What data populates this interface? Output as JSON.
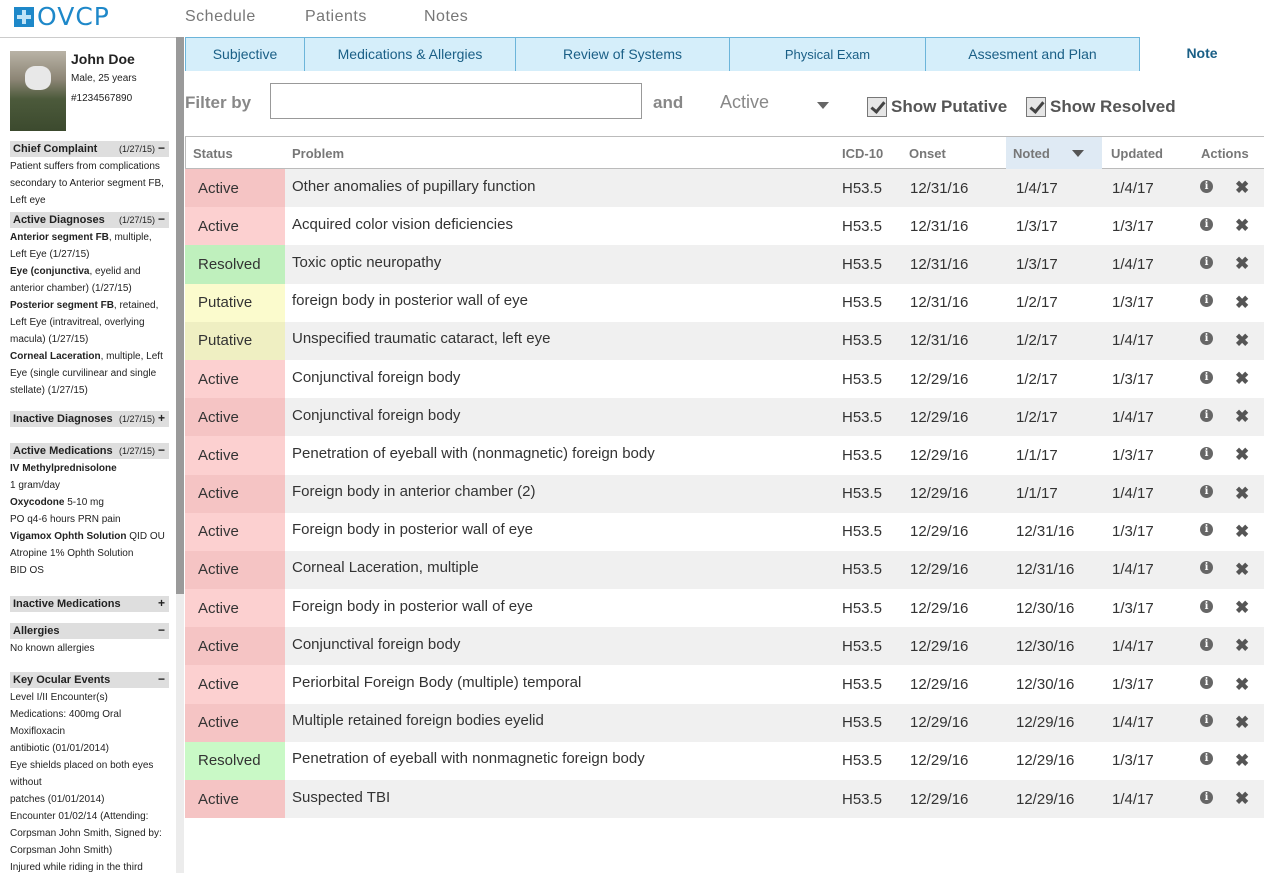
{
  "app": {
    "logo": "OVCP"
  },
  "nav": {
    "items": [
      "Schedule",
      "Patients",
      "Notes"
    ]
  },
  "patient": {
    "name": "John Doe",
    "info": "Male, 25 years",
    "id": "#1234567890"
  },
  "sidebar": {
    "chief": {
      "title": "Chief Complaint",
      "date": "(1/27/15)",
      "toggle": "−",
      "text": "Patient suffers from complications secondary to Anterior segment FB, Left eye"
    },
    "active_dx": {
      "title": "Active Diagnoses",
      "date": "(1/27/15)",
      "toggle": "−",
      "items": [
        {
          "bold": "Anterior segment FB",
          "rest": ", multiple, Left Eye (1/27/15)"
        },
        {
          "bold": "Eye (conjunctiva",
          "rest": ", eyelid and anterior chamber) (1/27/15)"
        },
        {
          "bold": "Posterior segment FB",
          "rest": ", retained, Left Eye (intravitreal, overlying macula) (1/27/15)"
        },
        {
          "bold": "Corneal Laceration",
          "rest": ", multiple, Left Eye (single curvilinear and single stellate) (1/27/15)"
        }
      ]
    },
    "inactive_dx": {
      "title": "Inactive Diagnoses",
      "date": "(1/27/15)",
      "toggle": "+"
    },
    "active_meds": {
      "title": "Active Medications",
      "date": "(1/27/15)",
      "toggle": "−",
      "items": [
        {
          "bold": "IV Methylprednisolone",
          "rest": ""
        },
        {
          "bold": "",
          "rest": "1 gram/day"
        },
        {
          "bold": "Oxycodone",
          "rest": " 5-10 mg"
        },
        {
          "bold": "",
          "rest": "PO q4-6 hours PRN pain"
        },
        {
          "bold": "Vigamox Ophth Solution",
          "rest": " QID OU"
        },
        {
          "bold": "",
          "rest": "Atropine 1% Ophth Solution"
        },
        {
          "bold": "",
          "rest": "BID OS"
        }
      ]
    },
    "inactive_meds": {
      "title": "Inactive Medications",
      "toggle": "+"
    },
    "allergies": {
      "title": "Allergies",
      "toggle": "−",
      "text": "No known allergies"
    },
    "events": {
      "title": "Key Ocular Events",
      "toggle": "−",
      "lines": [
        "Level I/II Encounter(s)",
        "Medications: 400mg Oral",
        "Moxifloxacin",
        "antibiotic (01/01/2014)",
        "Eye shields placed on both eyes",
        "without",
        "patches (01/01/2014)",
        "Encounter 01/02/14 (Attending:",
        "Corpsman John Smith, Signed by:",
        "Corpsman John Smith)",
        "Injured while riding in the third"
      ]
    }
  },
  "tabs": [
    "Subjective",
    "Medications & Allergies",
    "Review of Systems",
    "Physical Exam",
    "Assesment and Plan",
    "Note"
  ],
  "filter": {
    "label": "Filter by",
    "value": "",
    "and": "and",
    "status": "Active",
    "show_putative": "Show Putative",
    "show_resolved": "Show Resolved"
  },
  "table": {
    "columns": [
      "Status",
      "Problem",
      "ICD-10",
      "Onset",
      "Noted",
      "Updated",
      "Actions"
    ],
    "rows": [
      {
        "status": "Active",
        "problem": "Other anomalies of pupillary function",
        "icd": "H53.5",
        "onset": "12/31/16",
        "noted": "1/4/17",
        "updated": "1/4/17"
      },
      {
        "status": "Active",
        "problem": "Acquired color vision deficiencies",
        "icd": "H53.5",
        "onset": "12/31/16",
        "noted": "1/3/17",
        "updated": "1/3/17"
      },
      {
        "status": "Resolved",
        "problem": "Toxic optic neuropathy",
        "icd": "H53.5",
        "onset": "12/31/16",
        "noted": "1/3/17",
        "updated": "1/4/17"
      },
      {
        "status": "Putative",
        "problem": "foreign body in posterior wall of eye",
        "icd": "H53.5",
        "onset": "12/31/16",
        "noted": "1/2/17",
        "updated": "1/3/17"
      },
      {
        "status": "Putative",
        "problem": "Unspecified traumatic cataract, left eye",
        "icd": "H53.5",
        "onset": "12/31/16",
        "noted": "1/2/17",
        "updated": "1/4/17"
      },
      {
        "status": "Active",
        "problem": "Conjunctival foreign body",
        "icd": "H53.5",
        "onset": "12/29/16",
        "noted": "1/2/17",
        "updated": "1/3/17"
      },
      {
        "status": "Active",
        "problem": "Conjunctival foreign body",
        "icd": "H53.5",
        "onset": "12/29/16",
        "noted": "1/2/17",
        "updated": "1/4/17"
      },
      {
        "status": "Active",
        "problem": "Penetration of eyeball with (nonmagnetic) foreign body",
        "icd": "H53.5",
        "onset": "12/29/16",
        "noted": "1/1/17",
        "updated": "1/3/17"
      },
      {
        "status": "Active",
        "problem": "Foreign body in anterior chamber (2)",
        "icd": "H53.5",
        "onset": "12/29/16",
        "noted": "1/1/17",
        "updated": "1/4/17"
      },
      {
        "status": "Active",
        "problem": "Foreign body in posterior wall of eye",
        "icd": "H53.5",
        "onset": "12/29/16",
        "noted": "12/31/16",
        "updated": "1/3/17"
      },
      {
        "status": "Active",
        "problem": "Corneal Laceration, multiple",
        "icd": "H53.5",
        "onset": "12/29/16",
        "noted": "12/31/16",
        "updated": "1/4/17"
      },
      {
        "status": "Active",
        "problem": "Foreign body in posterior wall of eye",
        "icd": "H53.5",
        "onset": "12/29/16",
        "noted": "12/30/16",
        "updated": "1/3/17"
      },
      {
        "status": "Active",
        "problem": "Conjunctival foreign body",
        "icd": "H53.5",
        "onset": "12/29/16",
        "noted": "12/30/16",
        "updated": "1/4/17"
      },
      {
        "status": "Active",
        "problem": "Periorbital Foreign Body (multiple) temporal",
        "icd": "H53.5",
        "onset": "12/29/16",
        "noted": "12/30/16",
        "updated": "1/3/17"
      },
      {
        "status": "Active",
        "problem": "Multiple retained foreign bodies eyelid",
        "icd": "H53.5",
        "onset": "12/29/16",
        "noted": "12/29/16",
        "updated": "1/4/17"
      },
      {
        "status": "Resolved",
        "problem": "Penetration of eyeball with nonmagnetic foreign body",
        "icd": "H53.5",
        "onset": "12/29/16",
        "noted": "12/29/16",
        "updated": "1/3/17"
      },
      {
        "status": "Active",
        "problem": "Suspected TBI",
        "icd": "H53.5",
        "onset": "12/29/16",
        "noted": "12/29/16",
        "updated": "1/4/17"
      }
    ]
  },
  "icons": {
    "info": "info-icon",
    "remove": "close-icon",
    "logo": "medical-cross-icon"
  }
}
